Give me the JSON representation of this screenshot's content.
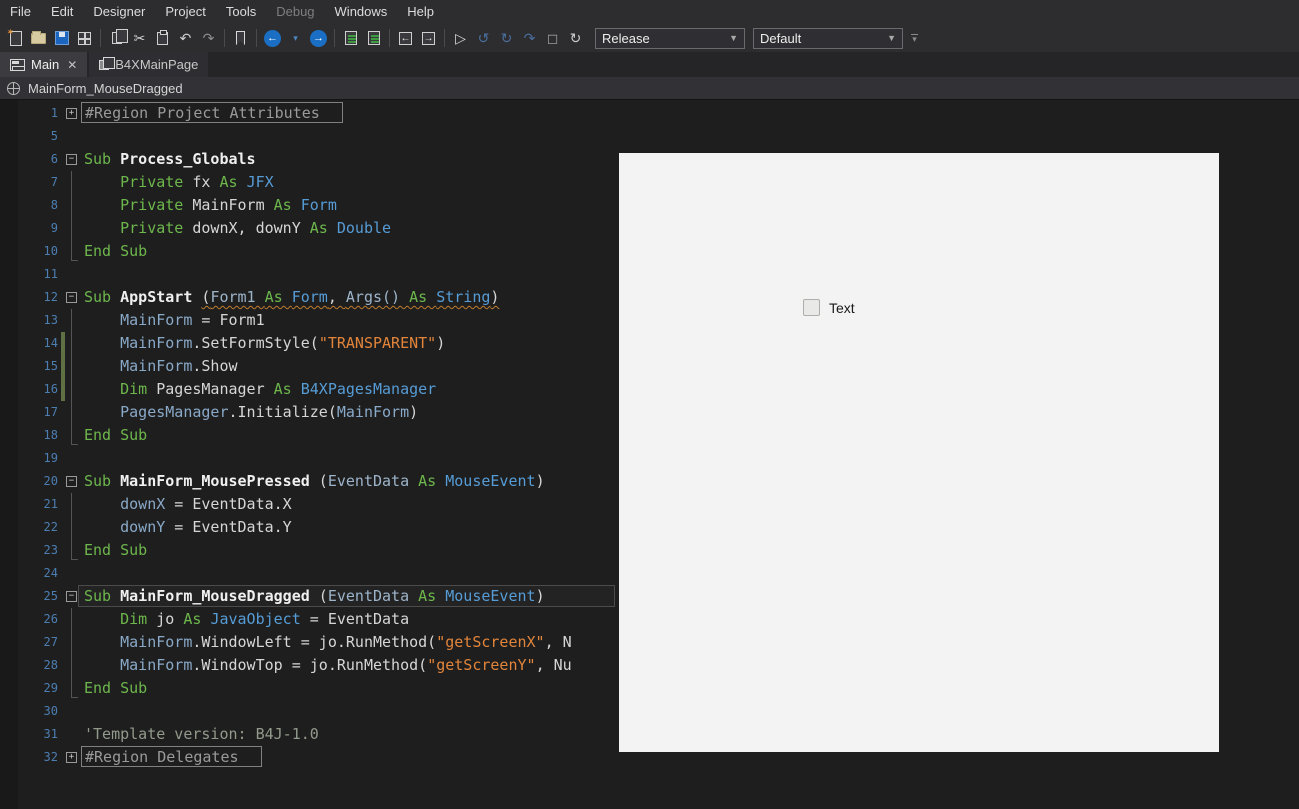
{
  "menubar": {
    "items": [
      {
        "label": "File",
        "enabled": true
      },
      {
        "label": "Edit",
        "enabled": true
      },
      {
        "label": "Designer",
        "enabled": true
      },
      {
        "label": "Project",
        "enabled": true
      },
      {
        "label": "Tools",
        "enabled": true
      },
      {
        "label": "Debug",
        "enabled": false
      },
      {
        "label": "Windows",
        "enabled": true
      },
      {
        "label": "Help",
        "enabled": true
      }
    ]
  },
  "toolbar": {
    "items": [
      {
        "name": "new-icon",
        "kind": "page-new"
      },
      {
        "name": "open-icon",
        "kind": "folder"
      },
      {
        "name": "save-icon",
        "kind": "floppy"
      },
      {
        "name": "modules-icon",
        "kind": "package"
      },
      {
        "name": "sep1",
        "kind": "sep"
      },
      {
        "name": "copy-icon",
        "kind": "copy"
      },
      {
        "name": "cut-icon",
        "kind": "glyph",
        "glyph": "✂",
        "color": "#cfcfcf"
      },
      {
        "name": "paste-icon",
        "kind": "paste"
      },
      {
        "name": "undo-icon",
        "kind": "glyph",
        "glyph": "↶",
        "color": "#cfcfcf"
      },
      {
        "name": "redo-icon",
        "kind": "glyph",
        "glyph": "↷",
        "color": "#8f8f8f"
      },
      {
        "name": "sep2",
        "kind": "sep"
      },
      {
        "name": "bookmark-icon",
        "kind": "bookmark"
      },
      {
        "name": "sep3",
        "kind": "sep"
      },
      {
        "name": "navigate-back-icon",
        "kind": "circle",
        "glyph": "←"
      },
      {
        "name": "back-history-dropdown-icon",
        "kind": "glyph",
        "glyph": "▾",
        "color": "#4f87c0",
        "small": true
      },
      {
        "name": "navigate-forward-icon",
        "kind": "circle",
        "glyph": "→"
      },
      {
        "name": "sep4",
        "kind": "sep"
      },
      {
        "name": "comment-icon",
        "kind": "doclines"
      },
      {
        "name": "uncomment-icon",
        "kind": "doclines"
      },
      {
        "name": "sep5",
        "kind": "sep"
      },
      {
        "name": "shift-left-icon",
        "kind": "docarrow",
        "glyph": "←"
      },
      {
        "name": "shift-right-icon",
        "kind": "docarrow",
        "glyph": "→"
      },
      {
        "name": "sep6",
        "kind": "sep"
      },
      {
        "name": "run-icon",
        "kind": "glyph",
        "glyph": "▷",
        "color": "#d8d8d8"
      },
      {
        "name": "debug-resume-icon",
        "kind": "glyph",
        "glyph": "↺",
        "color": "#4a6f9e"
      },
      {
        "name": "debug-step-icon",
        "kind": "glyph",
        "glyph": "↻",
        "color": "#4a6f9e"
      },
      {
        "name": "debug-step-over-icon",
        "kind": "glyph",
        "glyph": "↷",
        "color": "#4a6f9e"
      },
      {
        "name": "stop-icon",
        "kind": "glyph",
        "glyph": "◻",
        "color": "#9a9a9a"
      },
      {
        "name": "restart-icon",
        "kind": "glyph",
        "glyph": "↻",
        "color": "#cfcfcf"
      }
    ],
    "build_configuration": {
      "value": "Release"
    },
    "layout_variant": {
      "value": "Default"
    }
  },
  "tabs": [
    {
      "label": "Main",
      "active": true,
      "closable": true,
      "icon": "form-tab-icon"
    },
    {
      "label": "B4XMainPage",
      "active": false,
      "closable": false,
      "icon": "page-tab-icon"
    }
  ],
  "breadcrumb": {
    "label": "MainForm_MouseDragged",
    "icon": "module-cube-icon"
  },
  "editor": {
    "colors": {
      "background": "#1e1e1e",
      "keyword": "#6db74c",
      "type": "#569cd6",
      "variable": "#89a9c8",
      "string": "#e2853b",
      "comment": "#929a8c",
      "line_number": "#4c7eb2",
      "changed_line_bar": "#5f7144"
    },
    "lines": [
      {
        "n": 1,
        "fold": "+",
        "region": "#Region Project Attributes"
      },
      {
        "n": 5
      },
      {
        "n": 6,
        "fold": "-",
        "segs": [
          [
            "kw",
            "Sub "
          ],
          [
            "bold",
            "Process_Globals"
          ]
        ]
      },
      {
        "n": 7,
        "guide": "mid",
        "segs": [
          [
            "pln",
            "    "
          ],
          [
            "kw",
            "Private "
          ],
          [
            "pln",
            "fx "
          ],
          [
            "kw",
            "As "
          ],
          [
            "typ",
            "JFX"
          ]
        ]
      },
      {
        "n": 8,
        "guide": "mid",
        "segs": [
          [
            "pln",
            "    "
          ],
          [
            "kw",
            "Private "
          ],
          [
            "pln",
            "MainForm "
          ],
          [
            "kw",
            "As "
          ],
          [
            "typ",
            "Form"
          ]
        ]
      },
      {
        "n": 9,
        "guide": "mid",
        "segs": [
          [
            "pln",
            "    "
          ],
          [
            "kw",
            "Private "
          ],
          [
            "pln",
            "downX, downY "
          ],
          [
            "kw",
            "As "
          ],
          [
            "typ",
            "Double"
          ]
        ]
      },
      {
        "n": 10,
        "guide": "end",
        "segs": [
          [
            "kw",
            "End Sub"
          ]
        ]
      },
      {
        "n": 11
      },
      {
        "n": 12,
        "fold": "-",
        "segs": [
          [
            "kw",
            "Sub "
          ],
          [
            "bold",
            "AppStart"
          ],
          [
            "pln",
            " "
          ],
          [
            "pln",
            "(",
            1
          ],
          [
            "param",
            "Form1 ",
            1
          ],
          [
            "kw",
            "As ",
            1
          ],
          [
            "typ",
            "Form",
            1
          ],
          [
            "pln",
            ", ",
            1
          ],
          [
            "param",
            "Args() ",
            1
          ],
          [
            "kw",
            "As ",
            1
          ],
          [
            "typ",
            "String",
            1
          ],
          [
            "pln",
            ")",
            1
          ]
        ]
      },
      {
        "n": 13,
        "guide": "mid",
        "segs": [
          [
            "pln",
            "    "
          ],
          [
            "var",
            "MainForm"
          ],
          [
            "pln",
            " = Form1"
          ]
        ]
      },
      {
        "n": 14,
        "guide": "mid",
        "chg": 1,
        "segs": [
          [
            "pln",
            "    "
          ],
          [
            "var",
            "MainForm"
          ],
          [
            "pln",
            ".SetFormStyle("
          ],
          [
            "str",
            "\"TRANSPARENT\""
          ],
          [
            "pln",
            ")"
          ]
        ]
      },
      {
        "n": 15,
        "guide": "mid",
        "chg": 1,
        "segs": [
          [
            "pln",
            "    "
          ],
          [
            "var",
            "MainForm"
          ],
          [
            "pln",
            ".Show"
          ]
        ]
      },
      {
        "n": 16,
        "guide": "mid",
        "chg": 1,
        "segs": [
          [
            "pln",
            "    "
          ],
          [
            "kw",
            "Dim "
          ],
          [
            "pln",
            "PagesManager "
          ],
          [
            "kw",
            "As "
          ],
          [
            "typ",
            "B4XPagesManager"
          ]
        ]
      },
      {
        "n": 17,
        "guide": "mid",
        "segs": [
          [
            "pln",
            "    "
          ],
          [
            "var",
            "PagesManager"
          ],
          [
            "pln",
            ".Initialize("
          ],
          [
            "var",
            "MainForm"
          ],
          [
            "pln",
            ")"
          ]
        ]
      },
      {
        "n": 18,
        "guide": "end",
        "segs": [
          [
            "kw",
            "End Sub"
          ]
        ]
      },
      {
        "n": 19
      },
      {
        "n": 20,
        "fold": "-",
        "segs": [
          [
            "kw",
            "Sub "
          ],
          [
            "bold",
            "MainForm_MousePressed"
          ],
          [
            "pln",
            " ("
          ],
          [
            "param",
            "EventData"
          ],
          [
            "pln",
            " "
          ],
          [
            "kw",
            "As "
          ],
          [
            "typ",
            "MouseEvent"
          ],
          [
            "pln",
            ")"
          ]
        ]
      },
      {
        "n": 21,
        "guide": "mid",
        "segs": [
          [
            "pln",
            "    "
          ],
          [
            "var",
            "downX"
          ],
          [
            "pln",
            " = EventData.X"
          ]
        ]
      },
      {
        "n": 22,
        "guide": "mid",
        "segs": [
          [
            "pln",
            "    "
          ],
          [
            "var",
            "downY"
          ],
          [
            "pln",
            " = EventData.Y"
          ]
        ]
      },
      {
        "n": 23,
        "guide": "end",
        "segs": [
          [
            "kw",
            "End Sub"
          ]
        ]
      },
      {
        "n": 24
      },
      {
        "n": 25,
        "fold": "-",
        "cur": 1,
        "segs": [
          [
            "kw",
            "Sub "
          ],
          [
            "bold",
            "MainForm_MouseDragged"
          ],
          [
            "pln",
            " ("
          ],
          [
            "param",
            "EventData"
          ],
          [
            "pln",
            " "
          ],
          [
            "kw",
            "As "
          ],
          [
            "typ",
            "MouseEvent"
          ],
          [
            "pln",
            ")"
          ]
        ]
      },
      {
        "n": 26,
        "guide": "mid",
        "segs": [
          [
            "pln",
            "    "
          ],
          [
            "kw",
            "Dim "
          ],
          [
            "pln",
            "jo "
          ],
          [
            "kw",
            "As "
          ],
          [
            "typ",
            "JavaObject"
          ],
          [
            "pln",
            " = EventData"
          ]
        ]
      },
      {
        "n": 27,
        "guide": "mid",
        "segs": [
          [
            "pln",
            "    "
          ],
          [
            "var",
            "MainForm"
          ],
          [
            "pln",
            ".WindowLeft = jo.RunMethod("
          ],
          [
            "str",
            "\"getScreenX\""
          ],
          [
            "pln",
            ", N"
          ]
        ]
      },
      {
        "n": 28,
        "guide": "mid",
        "segs": [
          [
            "pln",
            "    "
          ],
          [
            "var",
            "MainForm"
          ],
          [
            "pln",
            ".WindowTop = jo.RunMethod("
          ],
          [
            "str",
            "\"getScreenY\""
          ],
          [
            "pln",
            ", Nu"
          ]
        ]
      },
      {
        "n": 29,
        "guide": "end",
        "segs": [
          [
            "kw",
            "End Sub"
          ]
        ]
      },
      {
        "n": 30
      },
      {
        "n": 31,
        "segs": [
          [
            "com",
            "'Template version: B4J-1.0"
          ]
        ]
      },
      {
        "n": 32,
        "fold": "+",
        "region": "#Region Delegates"
      }
    ]
  },
  "preview": {
    "background": "#f3f3f3",
    "checkbox": {
      "label": "Text",
      "checked": false
    }
  }
}
